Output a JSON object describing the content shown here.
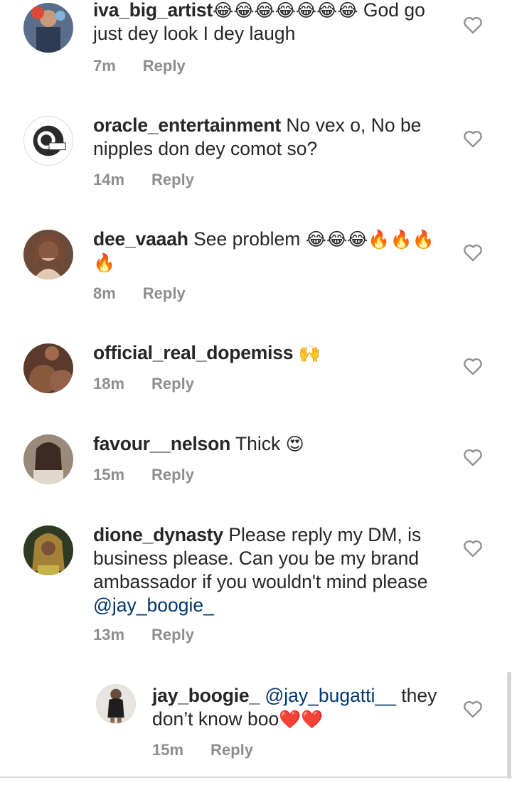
{
  "comments": [
    {
      "username": "iva_big_artist",
      "text_prefix": "",
      "emojis_inline": "😂😂😂😂😂😂😂",
      "text": " God go just dey look I dey laugh",
      "time": "7m",
      "reply": "Reply"
    },
    {
      "username": "oracle_entertainment",
      "text": " No vex o, No be nipples don dey comot so?",
      "time": "14m",
      "reply": "Reply"
    },
    {
      "username": "dee_vaaah",
      "text": " See problem ",
      "emojis_inline": "😂😂😂🔥🔥🔥🔥",
      "time": "8m",
      "reply": "Reply"
    },
    {
      "username": "official_real_dopemiss",
      "text": " ",
      "emojis_inline": "🙌",
      "time": "18m",
      "reply": "Reply"
    },
    {
      "username": "favour__nelson",
      "text": " Thick ",
      "emojis_inline": "😍",
      "time": "15m",
      "reply": "Reply"
    },
    {
      "username": "dione_dynasty",
      "text": " Please reply my DM, is business please. Can you be my brand ambassador if you wouldn't mind please ",
      "mention": "@jay_boogie_",
      "time": "13m",
      "reply": "Reply"
    },
    {
      "username": "jay_boogie_",
      "mention": "@jay_bugatti__",
      "text": " they don’t know boo",
      "emojis_inline": "❤️❤️",
      "time": "15m",
      "reply": "Reply"
    }
  ],
  "icons": {
    "like": "heart-outline-icon"
  },
  "colors": {
    "text": "#262626",
    "meta": "#8e8e8e",
    "mention": "#00376b"
  }
}
